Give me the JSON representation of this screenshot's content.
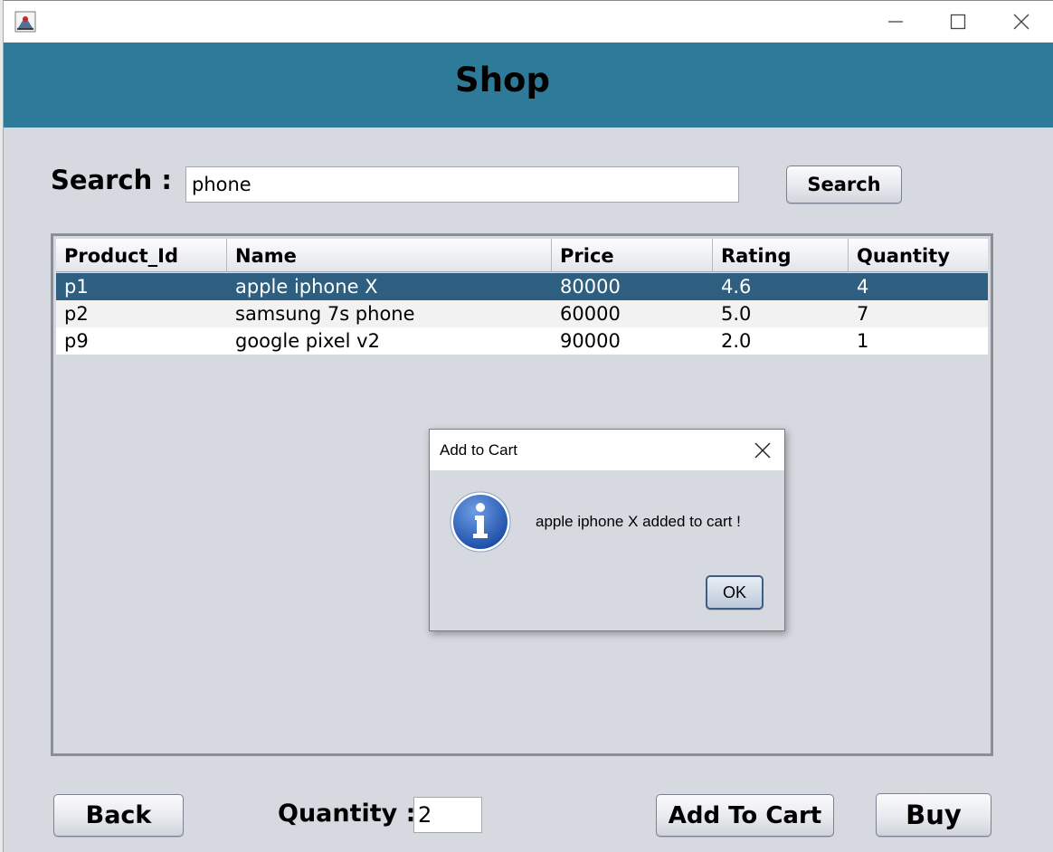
{
  "window": {
    "header_title": "Shop",
    "icon": "java-app-icon"
  },
  "search": {
    "label": "Search :",
    "value": "phone",
    "button_label": "Search"
  },
  "table": {
    "columns": [
      "Product_Id",
      "Name",
      "Price",
      "Rating",
      "Quantity"
    ],
    "rows": [
      [
        "p1",
        "apple iphone X",
        "80000",
        "4.6",
        "4"
      ],
      [
        "p2",
        "samsung 7s phone",
        "60000",
        "5.0",
        "7"
      ],
      [
        "p9",
        "google pixel v2",
        "90000",
        "2.0",
        "1"
      ]
    ],
    "selected_row": 0
  },
  "dialog": {
    "title": "Add to Cart",
    "icon": "info-icon",
    "message": "apple iphone X added to cart !",
    "ok_label": "OK"
  },
  "bottom": {
    "back_label": "Back",
    "quantity_label": "Quantity :",
    "quantity_value": "2",
    "add_to_cart_label": "Add To Cart",
    "buy_label": "Buy"
  },
  "colors": {
    "header": "#2e7b99",
    "selection": "#2f5f80",
    "background": "#d6d9e0"
  }
}
